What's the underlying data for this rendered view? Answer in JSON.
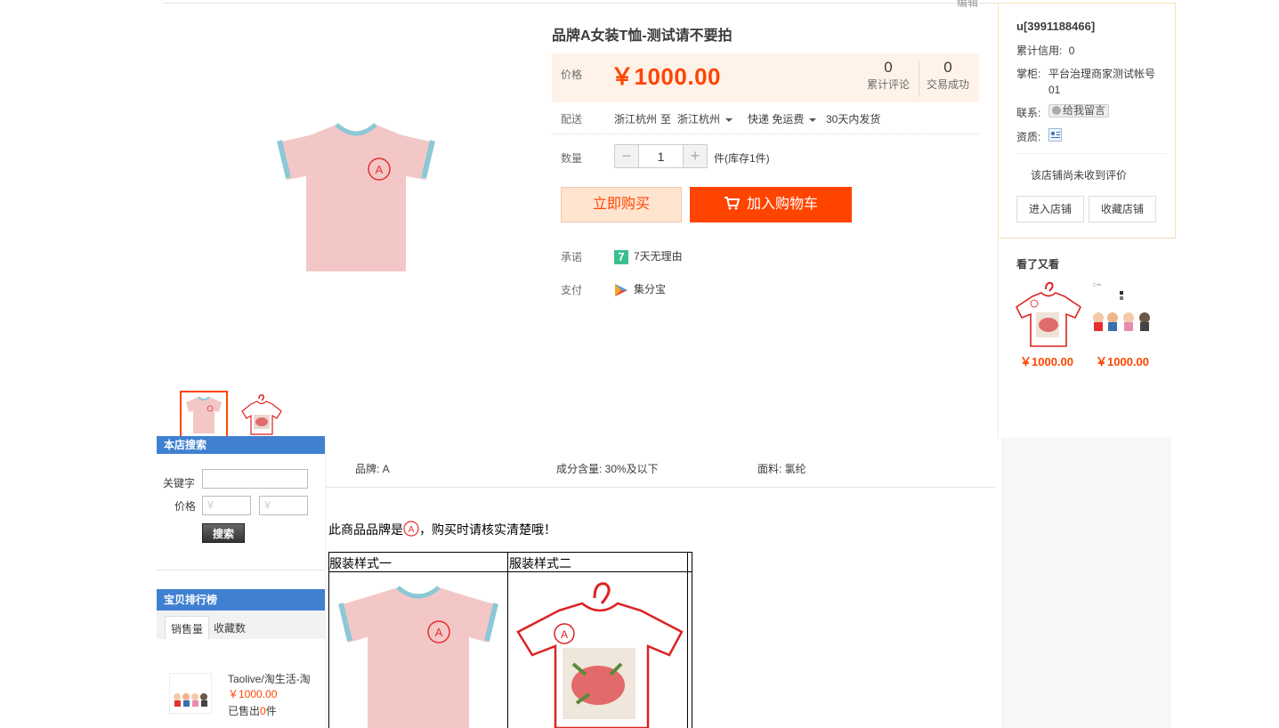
{
  "header": {
    "edit_link": "编辑"
  },
  "product": {
    "title": "品牌A女装T恤-测试请不要拍",
    "price_label": "价格",
    "price": "￥1000.00",
    "stats": [
      {
        "value": "0",
        "label": "累计评论"
      },
      {
        "value": "0",
        "label": "交易成功"
      }
    ],
    "delivery": {
      "label": "配送",
      "from": "浙江杭州",
      "to_word": "至",
      "to": "浙江杭州",
      "method": "快递 免运费",
      "ship_time": "30天内发货"
    },
    "quantity": {
      "label": "数量",
      "minus": "−",
      "plus": "+",
      "value": "1",
      "stock": "件(库存1件)"
    },
    "buttons": {
      "buy_now": "立即购买",
      "add_cart": "加入购物车"
    },
    "promise": {
      "label": "承诺",
      "badge": "7",
      "text": "7天无理由"
    },
    "payment": {
      "label": "支付",
      "text": "集分宝"
    }
  },
  "seller": {
    "name": "u[3991188466]",
    "credit_label": "累计信用:",
    "credit": "0",
    "keeper_label": "掌柜:",
    "keeper_line1": "平台治理商家测试帐号",
    "keeper_line2": "01",
    "contact_label": "联系:",
    "contact_button": "给我留言",
    "qualification_label": "资质:",
    "no_reviews": "该店铺尚未收到评价",
    "enter_shop": "进入店铺",
    "collect_shop": "收藏店铺"
  },
  "also_viewed": {
    "title": "看了又看",
    "items": [
      {
        "price": "￥1000.00"
      },
      {
        "price": "￥1000.00"
      }
    ]
  },
  "sidebar": {
    "search_title": "本店搜索",
    "keyword_label": "关键字",
    "price_label": "价格",
    "price_placeholder": "￥",
    "search_button": "搜索",
    "ranking_title": "宝贝排行榜",
    "tabs": [
      "销售量",
      "收藏数"
    ],
    "item": {
      "name": "Taolive/淘生活-淘",
      "price": "￥1000.00",
      "sold_prefix": "已售出",
      "sold_count": "0",
      "sold_suffix": "件"
    }
  },
  "attributes": [
    {
      "text": "品牌: A"
    },
    {
      "text": "成分含量: 30%及以下"
    },
    {
      "text": "面料: 氯纶"
    }
  ],
  "description": {
    "text_before": "此商品品牌是",
    "text_after": "，购买时请核实清楚哦！",
    "col1": "服装样式一",
    "col2": "服装样式二"
  },
  "colors": {
    "accent": "#ff4400",
    "price_bg": "#fff2e8",
    "sidebar_head": "#4080d0"
  }
}
